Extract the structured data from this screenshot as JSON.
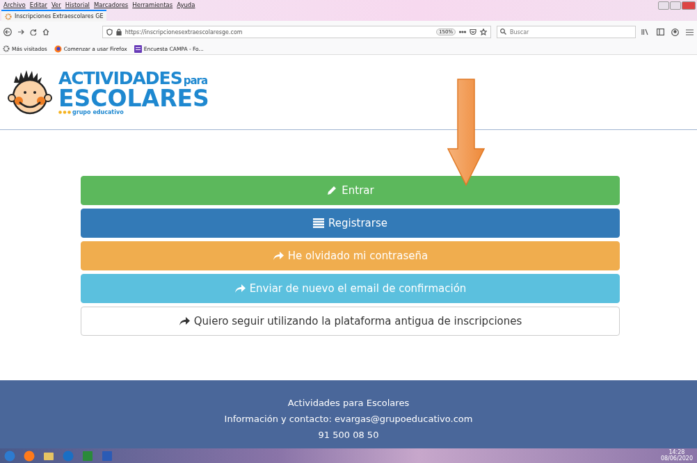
{
  "browser": {
    "menu": [
      "Archivo",
      "Editar",
      "Ver",
      "Historial",
      "Marcadores",
      "Herramientas",
      "Ayuda"
    ],
    "tab": {
      "title": "Inscripciones Extraescolares GE",
      "selected": true
    },
    "url": "https://inscripcionesextraescolaresge.com",
    "zoom": "150%",
    "search": {
      "placeholder": "Buscar"
    },
    "bookmarks": [
      {
        "label": "Más visitados"
      },
      {
        "label": "Comenzar a usar Firefox"
      },
      {
        "label": "Encuesta CAMPA - Fo..."
      }
    ]
  },
  "logo": {
    "line1": "ACTIVIDADES",
    "small": "para",
    "line2": "ESCOLARES",
    "tagline": "grupo educativo"
  },
  "buttons": [
    {
      "label": "Entrar",
      "kind": "edit",
      "color": "#5cb85c"
    },
    {
      "label": "Registrarse",
      "kind": "list",
      "color": "#337ab7"
    },
    {
      "label": "He olvidado mi contraseña",
      "kind": "link",
      "color": "#f0ad4e"
    },
    {
      "label": "Enviar de nuevo el email de confirmación",
      "kind": "link",
      "color": "#5bc0de"
    },
    {
      "label": "Quiero seguir utilizando la plataforma antigua de inscripciones",
      "kind": "link",
      "color": "#ffffff"
    }
  ],
  "footer": [
    "Actividades para Escolares",
    "Información y contacto: evargas@grupoeducativo.com",
    "91 500 08 50"
  ],
  "taskbar": {
    "time": "14:28",
    "date": "08/06/2020"
  }
}
